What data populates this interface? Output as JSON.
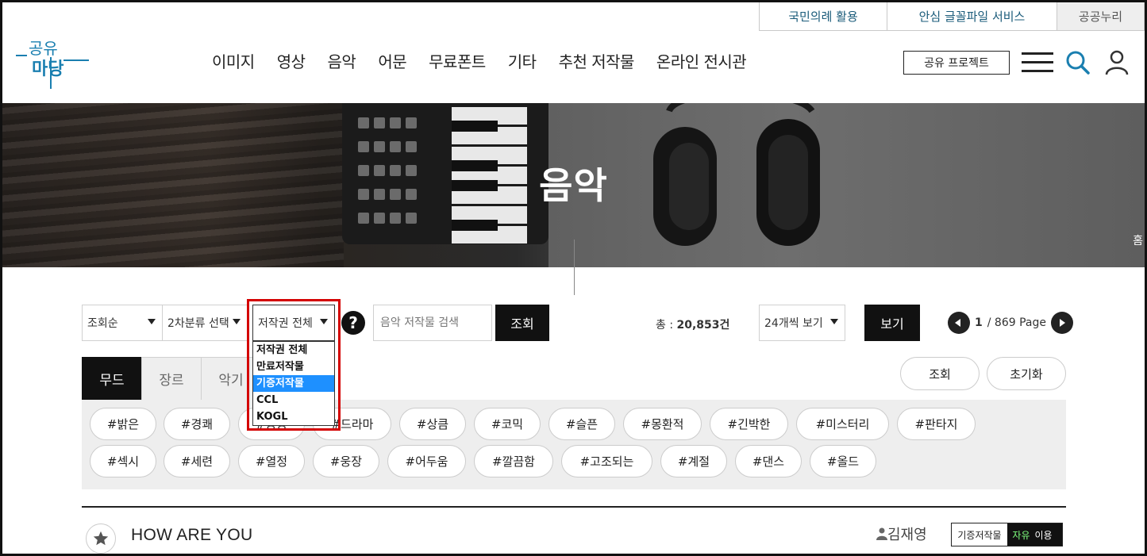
{
  "util_links": [
    "국민의례 활용",
    "안심 글꼴파일 서비스",
    "공공누리"
  ],
  "logo": {
    "text_top": "공유",
    "text_bottom": "마당"
  },
  "nav": [
    "이미지",
    "영상",
    "음악",
    "어문",
    "무료폰트",
    "기타",
    "추천 저작물",
    "온라인 전시관"
  ],
  "header": {
    "share_button": "공유 프로젝트",
    "icons": [
      "menu-icon",
      "search-icon",
      "user-icon"
    ]
  },
  "hero": {
    "title": "음악",
    "breadcrumb_home": "홈"
  },
  "filters": {
    "sort": "조회순",
    "category2": "2차분류 선택",
    "copyright": "저작권 전체",
    "copyright_options": [
      "저작권 전체",
      "만료저작물",
      "기증저작물",
      "CCL",
      "KOGL"
    ],
    "copyright_selected_index": 2,
    "help": "?",
    "search_placeholder": "음악 저작물 검색",
    "query_button": "조회",
    "total_label": "총 : ",
    "total_count": "20,853건",
    "per_page": "24개씩 보기",
    "view_button": "보기",
    "page_current": "1",
    "page_total": " / 869 Page"
  },
  "tabs": [
    "무드",
    "장르",
    "악기"
  ],
  "tab_active": "무드",
  "actions": {
    "query": "조회",
    "reset": "초기화"
  },
  "tags_row1": [
    "#밝은",
    "#경쾌",
    "#웅웅",
    "#드라마",
    "#상큼",
    "#코믹",
    "#슬픈",
    "#몽환적",
    "#긴박한",
    "#미스터리",
    "#판타지"
  ],
  "tags_row2": [
    "#섹시",
    "#세련",
    "#열정",
    "#웅장",
    "#어두움",
    "#깔끔함",
    "#고조되는",
    "#계절",
    "#댄스",
    "#올드"
  ],
  "item": {
    "title": "HOW ARE YOU",
    "author": "김재영",
    "license_type": "기증저작물",
    "license_use_highlight": "자유",
    "license_use_rest": "이용"
  },
  "colors": {
    "accent_blue": "#1a7fb0",
    "red_highlight": "#d40000",
    "dropdown_active": "#1e90ff"
  }
}
